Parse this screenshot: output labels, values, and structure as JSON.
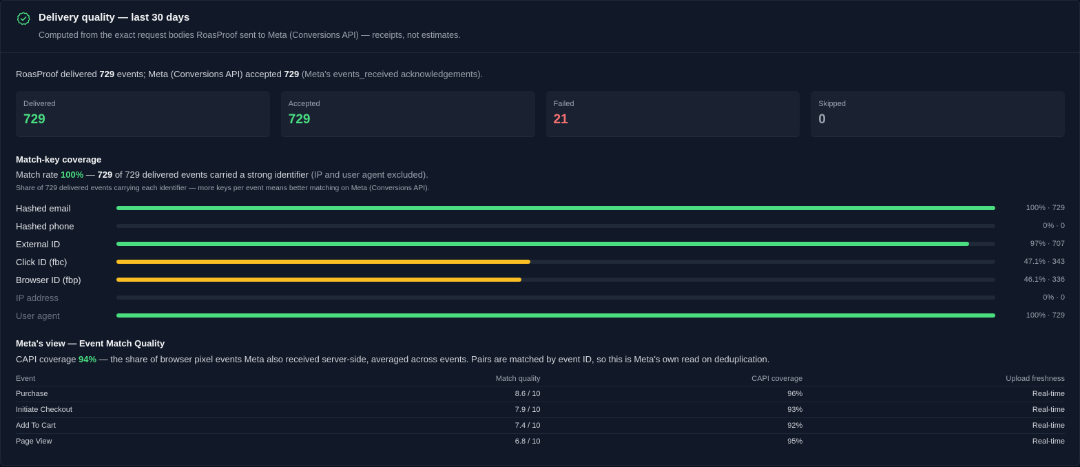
{
  "header": {
    "title": "Delivery quality — last 30 days",
    "subtitle": "Computed from the exact request bodies RoasProof sent to Meta (Conversions API) — receipts, not estimates."
  },
  "summary": {
    "prefix": "RoasProof delivered ",
    "delivered": "729",
    "middle": " events; Meta (Conversions API) accepted ",
    "accepted": "729",
    "suffix": "(Meta's events_received acknowledgements)."
  },
  "cards": [
    {
      "label": "Delivered",
      "value": "729",
      "color": "#4ade80"
    },
    {
      "label": "Accepted",
      "value": "729",
      "color": "#4ade80"
    },
    {
      "label": "Failed",
      "value": "21",
      "color": "#f87171"
    },
    {
      "label": "Skipped",
      "value": "0",
      "color": "#9ca3af"
    }
  ],
  "match": {
    "title": "Match-key coverage",
    "rate_prefix": "Match rate ",
    "rate": "100%",
    "dash": " — ",
    "count": "729",
    "rate_suffix": " of 729 delivered events carried a strong identifier ",
    "excluded": "(IP and user agent excluded).",
    "note": "Share of 729 delivered events carrying each identifier — more keys per event means better matching on Meta (Conversions API).",
    "rows": [
      {
        "label": "Hashed email",
        "value": "100% · 729",
        "fraction": 1.0,
        "color": "#4ade80",
        "dim": false
      },
      {
        "label": "Hashed phone",
        "value": "0% · 0",
        "fraction": 0.0,
        "color": "#4ade80",
        "dim": false
      },
      {
        "label": "External ID",
        "value": "97% · 707",
        "fraction": 0.97,
        "color": "#4ade80",
        "dim": false
      },
      {
        "label": "Click ID (fbc)",
        "value": "47.1% · 343",
        "fraction": 0.471,
        "color": "#fbbf24",
        "dim": false
      },
      {
        "label": "Browser ID (fbp)",
        "value": "46.1% · 336",
        "fraction": 0.461,
        "color": "#fbbf24",
        "dim": false
      },
      {
        "label": "IP address",
        "value": "0% · 0",
        "fraction": 0.0,
        "color": "#4ade80",
        "dim": true
      },
      {
        "label": "User agent",
        "value": "100% · 729",
        "fraction": 1.0,
        "color": "#4ade80",
        "dim": true
      }
    ]
  },
  "meta": {
    "title": "Meta's view — Event Match Quality",
    "capi_prefix": "CAPI coverage ",
    "capi": "94%",
    "capi_suffix": " — the share of browser pixel events Meta also received server-side, averaged across events. Pairs are matched by event ID, so this is Meta's own read on deduplication.",
    "columns": [
      "Event",
      "Match quality",
      "CAPI coverage",
      "Upload freshness"
    ],
    "rows": [
      [
        "Purchase",
        "8.6 / 10",
        "96%",
        "Real-time"
      ],
      [
        "Initiate Checkout",
        "7.9 / 10",
        "93%",
        "Real-time"
      ],
      [
        "Add To Cart",
        "7.4 / 10",
        "92%",
        "Real-time"
      ],
      [
        "Page View",
        "6.8 / 10",
        "95%",
        "Real-time"
      ]
    ]
  }
}
